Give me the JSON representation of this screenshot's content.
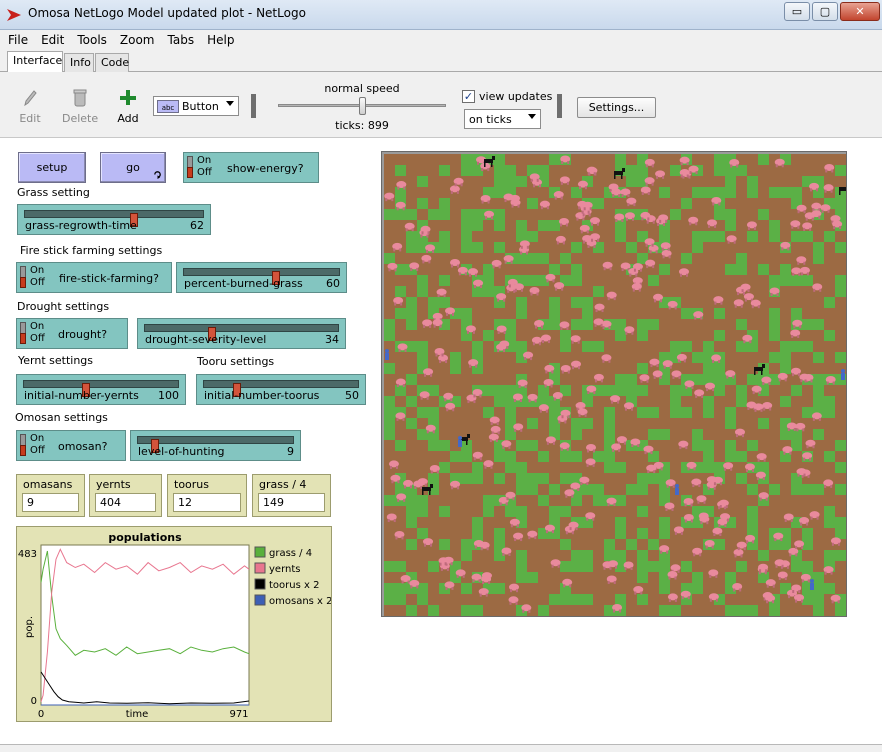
{
  "window": {
    "title": "Omosa NetLogo Model updated plot - NetLogo",
    "minimize": "▭",
    "maximize": "▢",
    "close": "✕"
  },
  "menu": [
    "File",
    "Edit",
    "Tools",
    "Zoom",
    "Tabs",
    "Help"
  ],
  "tabs": [
    "Interface",
    "Info",
    "Code"
  ],
  "toolbar": {
    "edit_label": "Edit",
    "delete_label": "Delete",
    "add_label": "Add",
    "widget_type": "Button",
    "speed_label": "normal speed",
    "ticks_label": "ticks: 899",
    "speed_value": 0.5,
    "view_updates_label": "view updates",
    "view_updates_checked": true,
    "update_mode": "on ticks",
    "settings_label": "Settings..."
  },
  "buttons": {
    "setup": "setup",
    "go": "go"
  },
  "switch_labels": {
    "on": "On",
    "off": "Off"
  },
  "switches": {
    "show_energy": "show-energy?",
    "fire_stick": "fire-stick-farming?",
    "drought": "drought?",
    "omosan": "omosan?"
  },
  "notes": {
    "grass": "Grass setting",
    "fire": "Fire stick farming settings",
    "drought": "Drought settings",
    "yernt": "Yernt settings",
    "tooru": "Tooru settings",
    "omosan": "Omosan settings"
  },
  "sliders": {
    "grass_regrowth": {
      "label": "grass-regrowth-time",
      "value": "62",
      "fraction": 0.62
    },
    "percent_burned": {
      "label": "percent-burned-grass",
      "value": "60",
      "fraction": 0.6
    },
    "drought_severity": {
      "label": "drought-severity-level",
      "value": "34",
      "fraction": 0.34
    },
    "initial_yernts": {
      "label": "initial-number-yernts",
      "value": "100",
      "fraction": 0.4
    },
    "initial_toorus": {
      "label": "initial-number-toorus",
      "value": "50",
      "fraction": 0.2
    },
    "level_hunting": {
      "label": "level-of-hunting",
      "value": "9",
      "fraction": 0.09
    }
  },
  "monitors": [
    {
      "label": "omasans",
      "value": "9"
    },
    {
      "label": "yernts",
      "value": "404"
    },
    {
      "label": "toorus",
      "value": "12"
    },
    {
      "label": "grass / 4",
      "value": "149"
    }
  ],
  "plot": {
    "title": "populations",
    "ylabel": "pop.",
    "xlabel": "time",
    "ymax_label": "483",
    "ymin_label": "0",
    "xmin_label": "0",
    "xmax_label": "971",
    "legend": [
      {
        "name": "grass / 4",
        "color": "#59b03c"
      },
      {
        "name": "yernts",
        "color": "#e8768f"
      },
      {
        "name": "toorus x 2",
        "color": "#000000"
      },
      {
        "name": "omosans x 2",
        "color": "#3d5fb5"
      }
    ]
  },
  "chart_data": {
    "type": "line",
    "title": "populations",
    "xlabel": "time",
    "ylabel": "pop.",
    "xlim": [
      0,
      971
    ],
    "ylim": [
      0,
      483
    ],
    "series": [
      {
        "name": "grass / 4",
        "color": "#59b03c",
        "x": [
          0,
          10,
          30,
          50,
          70,
          90,
          120,
          160,
          200,
          250,
          300,
          350,
          400,
          450,
          500,
          550,
          600,
          650,
          700,
          750,
          800,
          850,
          900,
          950,
          971
        ],
        "y": [
          370,
          410,
          465,
          330,
          230,
          200,
          180,
          150,
          165,
          160,
          170,
          150,
          175,
          155,
          160,
          165,
          170,
          155,
          175,
          165,
          160,
          170,
          175,
          160,
          155
        ]
      },
      {
        "name": "yernts",
        "color": "#e8768f",
        "x": [
          0,
          10,
          30,
          50,
          70,
          90,
          120,
          160,
          200,
          250,
          300,
          350,
          400,
          450,
          500,
          550,
          600,
          650,
          700,
          750,
          800,
          850,
          900,
          950,
          971
        ],
        "y": [
          10,
          30,
          160,
          340,
          440,
          470,
          430,
          415,
          425,
          400,
          430,
          410,
          420,
          395,
          430,
          405,
          415,
          430,
          400,
          420,
          410,
          425,
          395,
          420,
          410
        ]
      },
      {
        "name": "toorus x 2",
        "color": "#000000",
        "x": [
          0,
          20,
          40,
          60,
          80,
          100,
          130,
          160,
          200,
          260,
          320,
          400,
          500,
          600,
          700,
          800,
          900,
          971
        ],
        "y": [
          100,
          80,
          60,
          40,
          25,
          15,
          10,
          8,
          6,
          10,
          6,
          5,
          7,
          4,
          6,
          5,
          6,
          12
        ]
      },
      {
        "name": "omosans x 2",
        "color": "#3d5fb5",
        "x": [
          0,
          100,
          200,
          300,
          400,
          500,
          600,
          700,
          800,
          900,
          971
        ],
        "y": [
          0,
          0,
          0,
          0,
          0,
          0,
          0,
          0,
          0,
          0,
          0
        ]
      }
    ]
  }
}
